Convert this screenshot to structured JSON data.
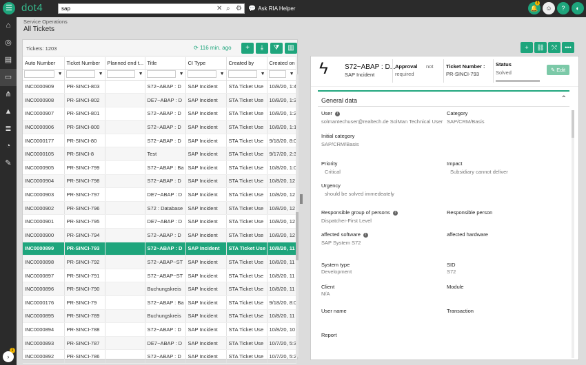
{
  "app": {
    "logo": "dot4"
  },
  "header": {
    "search_value": "sap",
    "ria_label": "Ask RIA Helper",
    "notification_badge": "1"
  },
  "sidebar": {
    "icons": [
      "home-icon",
      "globe-icon",
      "document-icon",
      "ticket-icon",
      "network-icon",
      "education-icon",
      "database-icon",
      "chart-pie-icon",
      "wrench-icon"
    ],
    "bottom_badge": "1"
  },
  "page": {
    "breadcrumb": "Service Operations",
    "title": "All Tickets"
  },
  "list": {
    "count_label": "Tickets: 1203",
    "refresh_label": "116 min. ago",
    "columns": [
      "Auto Number",
      "Ticket Number",
      "Planned end t...",
      "Title",
      "CI Type",
      "Created by",
      "Created on"
    ],
    "rows": [
      [
        "INC0000909",
        "PR-SINCI-803",
        "",
        "S72~ABAP : D",
        "SAP Incident",
        "STA Ticket Use",
        "10/8/20, 1:4"
      ],
      [
        "INC0000908",
        "PR-SINCI-802",
        "",
        "DE7~ABAP : D",
        "SAP Incident",
        "STA Ticket Use",
        "10/8/20, 1:3"
      ],
      [
        "INC0000907",
        "PR-SINCI-801",
        "",
        "S72~ABAP : D",
        "SAP Incident",
        "STA Ticket Use",
        "10/8/20, 1:2"
      ],
      [
        "INC0000906",
        "PR-SINCI-800",
        "",
        "S72~ABAP : D",
        "SAP Incident",
        "STA Ticket Use",
        "10/8/20, 1:1"
      ],
      [
        "INC0000177",
        "PR-SINCI-80",
        "",
        "S72~ABAP : D",
        "SAP Incident",
        "STA Ticket Use",
        "9/18/20, 8:0"
      ],
      [
        "INC0000105",
        "PR-SINCI-8",
        "",
        "Test",
        "SAP Incident",
        "STA Ticket Use",
        "9/17/20, 2:3"
      ],
      [
        "INC0000905",
        "PR-SINCI-799",
        "",
        "S72~ABAP : Ba",
        "SAP Incident",
        "STA Ticket Use",
        "10/8/20, 1:0"
      ],
      [
        "INC0000904",
        "PR-SINCI-798",
        "",
        "S72~ABAP : D",
        "SAP Incident",
        "STA Ticket Use",
        "10/8/20, 12"
      ],
      [
        "INC0000903",
        "PR-SINCI-797",
        "",
        "DE7~ABAP : D",
        "SAP Incident",
        "STA Ticket Use",
        "10/8/20, 12"
      ],
      [
        "INC0000902",
        "PR-SINCI-796",
        "",
        "S72 : Database",
        "SAP Incident",
        "STA Ticket Use",
        "10/8/20, 12"
      ],
      [
        "INC0000901",
        "PR-SINCI-795",
        "",
        "DE7~ABAP : D",
        "SAP Incident",
        "STA Ticket Use",
        "10/8/20, 12"
      ],
      [
        "INC0000900",
        "PR-SINCI-794",
        "",
        "S72~ABAP : D",
        "SAP Incident",
        "STA Ticket Use",
        "10/8/20, 12"
      ],
      [
        "INC0000899",
        "PR-SINCI-793",
        "",
        "S72~ABAP : D",
        "SAP Incident",
        "STA Ticket Use",
        "10/8/20, 11"
      ],
      [
        "INC0000898",
        "PR-SINCI-792",
        "",
        "S72~ABAP~ST",
        "SAP Incident",
        "STA Ticket Use",
        "10/8/20, 11"
      ],
      [
        "INC0000897",
        "PR-SINCI-791",
        "",
        "S72~ABAP~ST",
        "SAP Incident",
        "STA Ticket Use",
        "10/8/20, 11"
      ],
      [
        "INC0000896",
        "PR-SINCI-790",
        "",
        "Buchungskreis",
        "SAP Incident",
        "STA Ticket Use",
        "10/8/20, 11"
      ],
      [
        "INC0000176",
        "PR-SINCI-79",
        "",
        "S72~ABAP : Ba",
        "SAP Incident",
        "STA Ticket Use",
        "9/18/20, 8:0"
      ],
      [
        "INC0000895",
        "PR-SINCI-789",
        "",
        "Buchungskreis",
        "SAP Incident",
        "STA Ticket Use",
        "10/8/20, 11"
      ],
      [
        "INC0000894",
        "PR-SINCI-788",
        "",
        "S72~ABAP : D",
        "SAP Incident",
        "STA Ticket Use",
        "10/8/20, 10"
      ],
      [
        "INC0000893",
        "PR-SINCI-787",
        "",
        "DE7~ABAP : D",
        "SAP Incident",
        "STA Ticket Use",
        "10/7/20, 5:3"
      ],
      [
        "INC0000892",
        "PR-SINCI-786",
        "",
        "S72~ABAP : D",
        "SAP Incident",
        "STA Ticket Use",
        "10/7/20, 5:2"
      ]
    ],
    "selected_index": 12
  },
  "detail": {
    "title": "S72~ABAP : D...",
    "subtitle": "SAP Incident",
    "approval_label": "Approval",
    "approval_value": "not",
    "approval_value2": "required",
    "ticket_number_label": "Ticket Number :",
    "ticket_number_value": "PR-SINCI-793",
    "status_label": "Status",
    "status_value": "Solved",
    "edit_label": "Edit",
    "section_title": "General data",
    "fields": {
      "user_label": "User",
      "user_value": "solmantechuser@realtech.de SolMan Technical User",
      "category_label": "Category",
      "category_value": "SAP/CRM/Basis",
      "initial_category_label": "Initial category",
      "initial_category_value": "SAP/CRM/Basis",
      "priority_label": "Priority",
      "priority_value": "Critical",
      "impact_label": "Impact",
      "impact_value": "Subsidiary cannot deliver",
      "urgency_label": "Urgency",
      "urgency_value": "should be solved immedeately",
      "responsible_group_label": "Responsible group of persons",
      "responsible_group_value": "Dispatcher-First Level",
      "responsible_person_label": "Responsible person",
      "affected_software_label": "affected software",
      "affected_software_value": "SAP System S72",
      "affected_hardware_label": "affected hardware",
      "system_type_label": "System type",
      "system_type_value": "Development",
      "sid_label": "SID",
      "sid_value": "S72",
      "client_label": "Client",
      "client_value": "N/A",
      "module_label": "Module",
      "user_name_label": "User name",
      "transaction_label": "Transaction",
      "report_label": "Report"
    }
  },
  "colors": {
    "accent": "#1ea57c",
    "topbar": "#2b2b2b"
  }
}
